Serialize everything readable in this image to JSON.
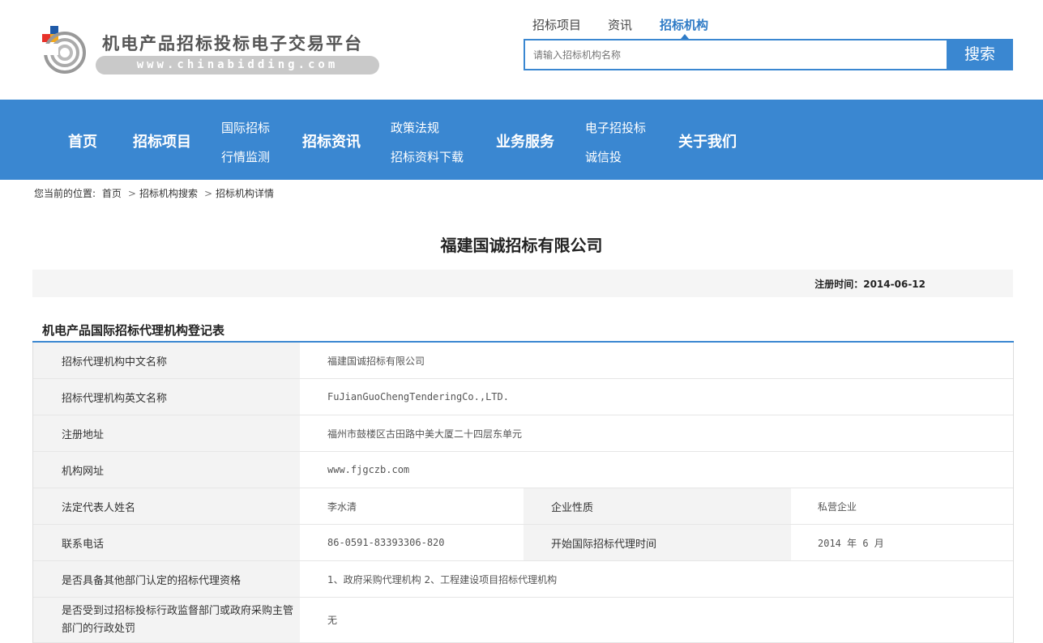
{
  "logo": {
    "title": "机电产品招标投标电子交易平台",
    "url_text": "www.chinabidding.com"
  },
  "search": {
    "tabs": [
      {
        "label": "招标项目"
      },
      {
        "label": "资讯"
      },
      {
        "label": "招标机构"
      }
    ],
    "active_tab": 2,
    "placeholder": "请输入招标机构名称",
    "button_label": "搜索"
  },
  "nav": {
    "home": "首页",
    "projects": "招标项目",
    "intl_bid": "国际招标",
    "market_monitor": "行情监测",
    "news": "招标资讯",
    "policy": "政策法规",
    "docs_download": "招标资料下载",
    "services": "业务服务",
    "e_bid": "电子招投标",
    "credit": "诚信投",
    "about": "关于我们"
  },
  "breadcrumb": {
    "prefix": "您当前的位置:",
    "items": [
      "首页",
      "招标机构搜索",
      "招标机构详情"
    ]
  },
  "company": {
    "name": "福建国诚招标有限公司",
    "reg_time_label": "注册时间：",
    "reg_time": "2014-06-12"
  },
  "section": {
    "title": "机电产品国际招标代理机构登记表"
  },
  "table": {
    "cn_name_label": "招标代理机构中文名称",
    "cn_name": "福建国诚招标有限公司",
    "en_name_label": "招标代理机构英文名称",
    "en_name": "FuJianGuoChengTenderingCo.,LTD.",
    "address_label": "注册地址",
    "address": "福州市鼓楼区古田路中美大厦二十四层东单元",
    "website_label": "机构网址",
    "website": "www.fjgczb.com",
    "legal_rep_label": "法定代表人姓名",
    "legal_rep": "李水清",
    "nature_label": "企业性质",
    "nature": "私营企业",
    "phone_label": "联系电话",
    "phone": "86-0591-83393306-820",
    "start_time_label": "开始国际招标代理时间",
    "start_time": "2014 年 6 月",
    "other_qual_label": "是否具备其他部门认定的招标代理资格",
    "other_qual": "1、政府采购代理机构 2、工程建设项目招标代理机构",
    "penalty_label": "是否受到过招标投标行政监督部门或政府采购主管部门的行政处罚",
    "penalty": "无"
  },
  "colors": {
    "brand_blue": "#3a87d1",
    "label_bg": "#f3f3f3"
  }
}
